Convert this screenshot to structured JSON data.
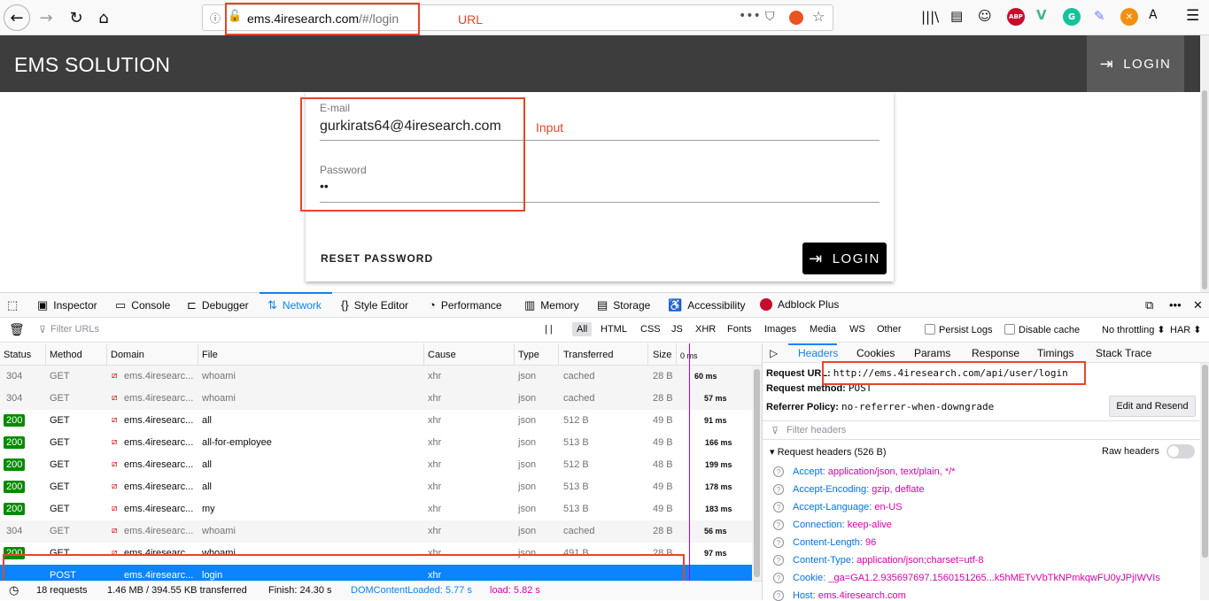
{
  "browser": {
    "url_host": "ems.4iresearch.com",
    "url_path": "/#/login",
    "url_annotation": "URL"
  },
  "app": {
    "title_bold": "EMS",
    "title_rest": "SOLUTION",
    "header_login": "LOGIN"
  },
  "login_card": {
    "email_label": "E-mail",
    "email_value": "gurkirats64@4iresearch.com",
    "input_annotation": "Input",
    "password_label": "Password",
    "password_value": "••",
    "reset_button": "RESET PASSWORD",
    "login_button": "LOGIN"
  },
  "devtools": {
    "tabs": [
      "Inspector",
      "Console",
      "Debugger",
      "Network",
      "Style Editor",
      "Performance",
      "Memory",
      "Storage",
      "Accessibility",
      "Adblock Plus"
    ],
    "filter_placeholder": "Filter URLs",
    "filter_types": [
      "All",
      "HTML",
      "CSS",
      "JS",
      "XHR",
      "Fonts",
      "Images",
      "Media",
      "WS",
      "Other"
    ],
    "persist_logs": "Persist Logs",
    "disable_cache": "Disable cache",
    "throttling": "No throttling ⬍",
    "har": "HAR ⬍",
    "columns": [
      "Status",
      "Method",
      "Domain",
      "File",
      "Cause",
      "Type",
      "Transferred",
      "Size",
      "0 ms"
    ],
    "requests": [
      {
        "status": "304",
        "method": "GET",
        "domain": "ems.4iresearc...",
        "file": "whoami",
        "cause": "xhr",
        "type": "json",
        "transferred": "cached",
        "size": "28 B",
        "time": "60 ms"
      },
      {
        "status": "304",
        "method": "GET",
        "domain": "ems.4iresearc...",
        "file": "whoami",
        "cause": "xhr",
        "type": "json",
        "transferred": "cached",
        "size": "28 B",
        "time": "57 ms"
      },
      {
        "status": "200",
        "method": "GET",
        "domain": "ems.4iresearc...",
        "file": "all",
        "cause": "xhr",
        "type": "json",
        "transferred": "512 B",
        "size": "49 B",
        "time": "91 ms"
      },
      {
        "status": "200",
        "method": "GET",
        "domain": "ems.4iresearc...",
        "file": "all-for-employee",
        "cause": "xhr",
        "type": "json",
        "transferred": "513 B",
        "size": "49 B",
        "time": "166 ms"
      },
      {
        "status": "200",
        "method": "GET",
        "domain": "ems.4iresearc...",
        "file": "all",
        "cause": "xhr",
        "type": "json",
        "transferred": "512 B",
        "size": "48 B",
        "time": "199 ms"
      },
      {
        "status": "200",
        "method": "GET",
        "domain": "ems.4iresearc...",
        "file": "all",
        "cause": "xhr",
        "type": "json",
        "transferred": "513 B",
        "size": "49 B",
        "time": "178 ms"
      },
      {
        "status": "200",
        "method": "GET",
        "domain": "ems.4iresearc...",
        "file": "my",
        "cause": "xhr",
        "type": "json",
        "transferred": "513 B",
        "size": "49 B",
        "time": "183 ms"
      },
      {
        "status": "304",
        "method": "GET",
        "domain": "ems.4iresearc...",
        "file": "whoami",
        "cause": "xhr",
        "type": "json",
        "transferred": "cached",
        "size": "28 B",
        "time": "56 ms"
      },
      {
        "status": "200",
        "method": "GET",
        "domain": "ems.4iresearc...",
        "file": "whoami",
        "cause": "xhr",
        "type": "json",
        "transferred": "491 B",
        "size": "28 B",
        "time": "97 ms"
      },
      {
        "status": "",
        "method": "POST",
        "domain": "ems.4iresearc...",
        "file": "login",
        "cause": "xhr",
        "type": "",
        "transferred": "",
        "size": "",
        "time": ""
      }
    ],
    "status_bar": {
      "requests": "18 requests",
      "transferred": "1.46 MB / 394.55 KB transferred",
      "finish": "Finish: 24.30 s",
      "dom_loaded": "DOMContentLoaded: 5.77 s",
      "load": "load: 5.82 s"
    },
    "side_tabs": [
      "Headers",
      "Cookies",
      "Params",
      "Response",
      "Timings",
      "Stack Trace"
    ],
    "request_url_label": "Request URL:",
    "request_url": "http://ems.4iresearch.com/api/user/login",
    "request_method_label": "Request method:",
    "request_method": "POST",
    "referrer_label": "Referrer Policy:",
    "referrer_value": "no-referrer-when-downgrade",
    "edit_resend": "Edit and Resend",
    "filter_headers": "Filter headers",
    "request_headers_title": "Request headers (526 B)",
    "raw_headers": "Raw headers",
    "headers": [
      {
        "name": "Accept:",
        "value": "application/json, text/plain, */*"
      },
      {
        "name": "Accept-Encoding:",
        "value": "gzip, deflate"
      },
      {
        "name": "Accept-Language:",
        "value": "en-US"
      },
      {
        "name": "Connection:",
        "value": "keep-alive"
      },
      {
        "name": "Content-Length:",
        "value": "96"
      },
      {
        "name": "Content-Type:",
        "value": "application/json;charset=utf-8"
      },
      {
        "name": "Cookie:",
        "value": "_ga=GA1.2.935697697.1560151265...k5hMETvVbTkNPmkqwFU0yJPjIWVIs"
      },
      {
        "name": "Host:",
        "value": "ems.4iresearch.com"
      }
    ]
  }
}
